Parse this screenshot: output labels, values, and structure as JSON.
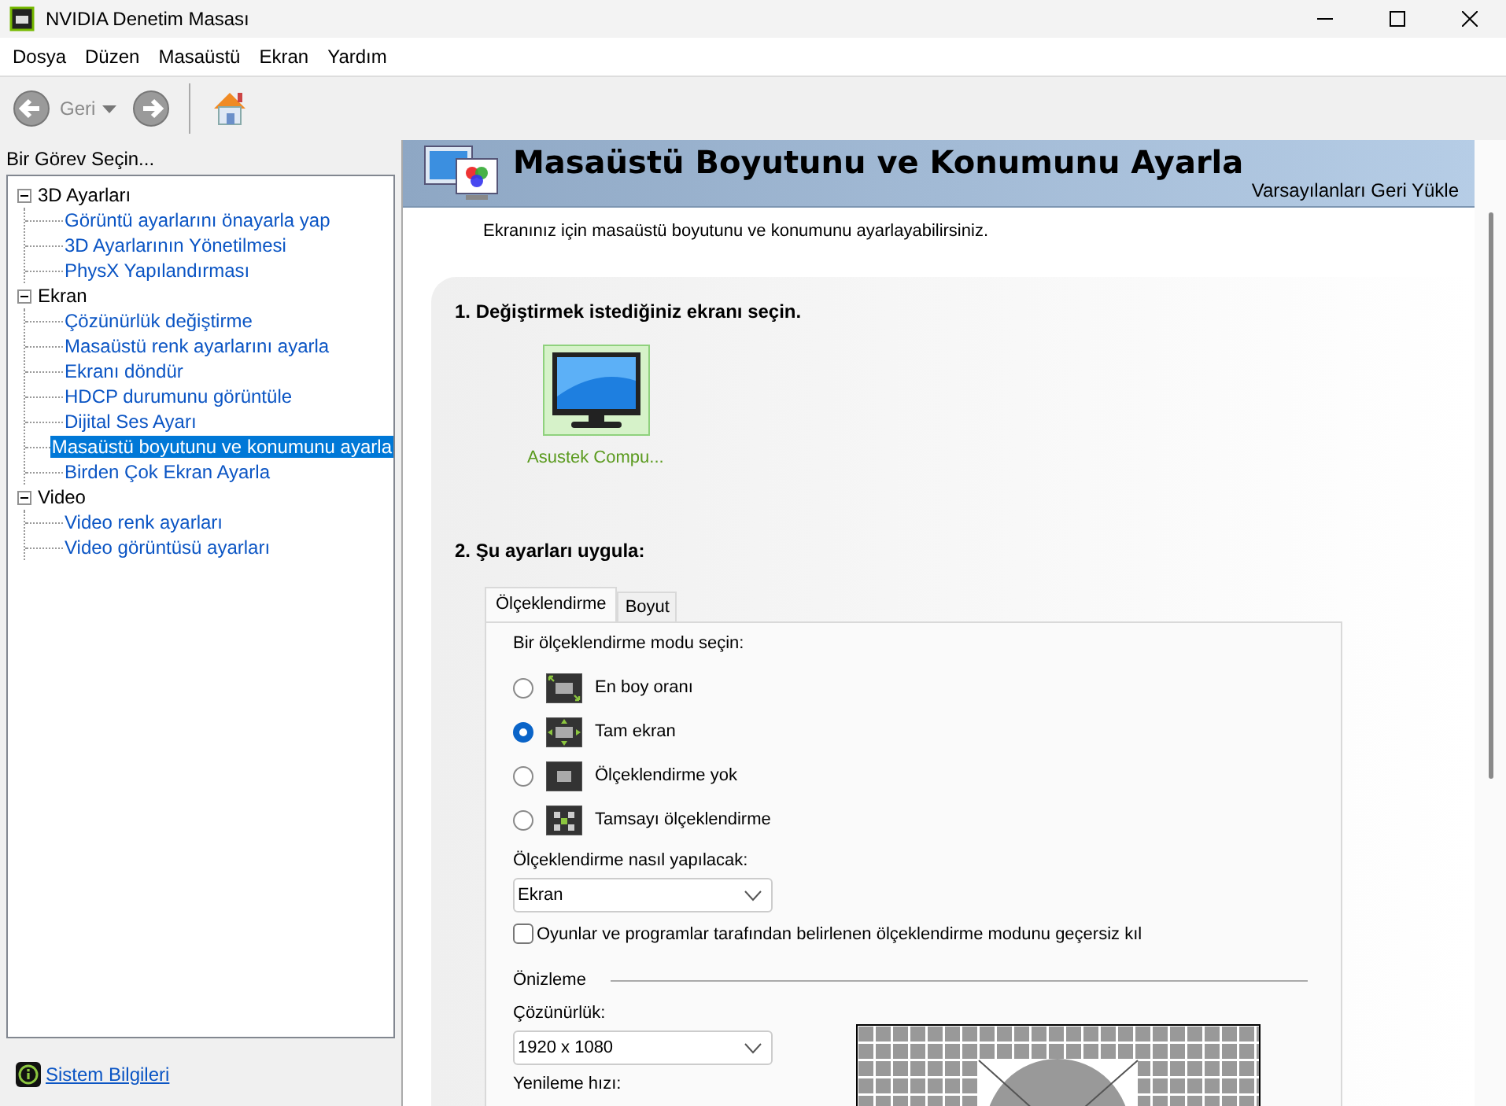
{
  "window": {
    "title": "NVIDIA Denetim Masası"
  },
  "menu": [
    "Dosya",
    "Düzen",
    "Masaüstü",
    "Ekran",
    "Yardım"
  ],
  "toolbar": {
    "back_label": "Geri"
  },
  "sidebar": {
    "heading": "Bir Görev Seçin...",
    "tree": [
      {
        "label": "3D Ayarları",
        "expanded": true,
        "children": [
          {
            "label": "Görüntü ayarlarını önayarla yap",
            "selected": false
          },
          {
            "label": "3D Ayarlarının Yönetilmesi",
            "selected": false
          },
          {
            "label": "PhysX Yapılandırması",
            "selected": false
          }
        ]
      },
      {
        "label": "Ekran",
        "expanded": true,
        "children": [
          {
            "label": "Çözünürlük değiştirme",
            "selected": false
          },
          {
            "label": "Masaüstü renk ayarlarını ayarla",
            "selected": false
          },
          {
            "label": "Ekranı döndür",
            "selected": false
          },
          {
            "label": "HDCP durumunu görüntüle",
            "selected": false
          },
          {
            "label": "Dijital Ses Ayarı",
            "selected": false
          },
          {
            "label": "Masaüstü boyutunu ve konumunu ayarla",
            "selected": true
          },
          {
            "label": "Birden Çok Ekran Ayarla",
            "selected": false
          }
        ]
      },
      {
        "label": "Video",
        "expanded": true,
        "children": [
          {
            "label": "Video renk ayarları",
            "selected": false
          },
          {
            "label": "Video görüntüsü ayarları",
            "selected": false
          }
        ]
      }
    ],
    "footer_link": "Sistem Bilgileri"
  },
  "page": {
    "title": "Masaüstü Boyutunu ve Konumunu Ayarla",
    "restore_link": "Varsayılanları Geri Yükle",
    "description": "Ekranınız için masaüstü boyutunu ve konumunu ayarlayabilirsiniz.",
    "step1": {
      "heading": "1. Değiştirmek istediğiniz ekranı seçin.",
      "displays": [
        {
          "label": "Asustek Compu...",
          "selected": true
        }
      ]
    },
    "step2": {
      "heading": "2. Şu ayarları uygula:",
      "tabs": [
        {
          "label": "Ölçeklendirme",
          "selected": true
        },
        {
          "label": "Boyut",
          "selected": false
        }
      ],
      "mode_label": "Bir ölçeklendirme modu seçin:",
      "modes": [
        {
          "label": "En boy oranı",
          "kind": "aspect",
          "selected": false
        },
        {
          "label": "Tam ekran",
          "kind": "full",
          "selected": true
        },
        {
          "label": "Ölçeklendirme yok",
          "kind": "none",
          "selected": false
        },
        {
          "label": "Tamsayı ölçeklendirme",
          "kind": "integer",
          "selected": false
        }
      ],
      "method_label": "Ölçeklendirme nasıl yapılacak:",
      "method": {
        "value": "Ekran"
      },
      "override": {
        "label": "Oyunlar ve programlar tarafından belirlenen ölçeklendirme modunu geçersiz kıl",
        "checked": false
      },
      "preview_heading": "Önizleme",
      "resolution_label": "Çözünürlük:",
      "resolution": {
        "value": "1920 x 1080"
      },
      "refresh_label": "Yenileme hızı:"
    }
  }
}
